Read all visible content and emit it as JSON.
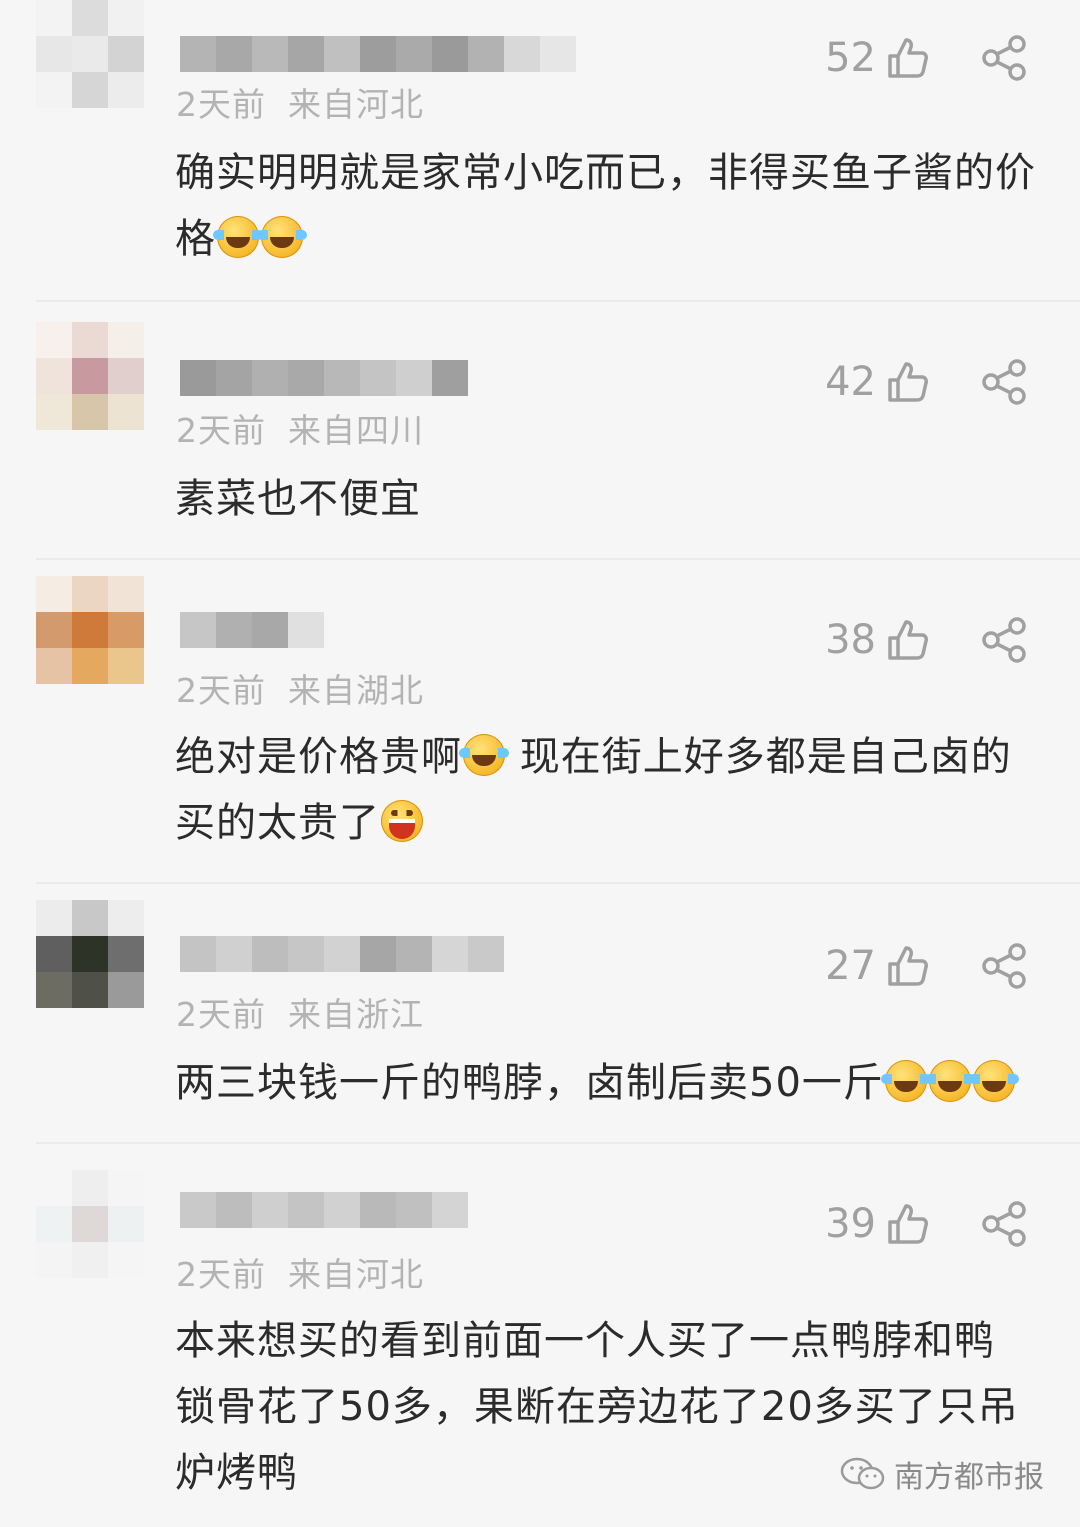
{
  "comments": [
    {
      "time": "2天前",
      "location": "来自河北",
      "likes": "52",
      "text": "确实明明就是家常小吃而已，非得买鱼子酱的价格",
      "emoji_after": [
        "laugh-cry-emoji",
        "laugh-cry-emoji"
      ],
      "avatar_colors": [
        "#f3f3f3",
        "#dcdcdc",
        "#f1f1f1",
        "#e7e7e7",
        "#eaeaea",
        "#d3d3d3",
        "#f3f3f3",
        "#d6d6d6",
        "#ececec"
      ]
    },
    {
      "time": "2天前",
      "location": "来自四川",
      "likes": "42",
      "text": "素菜也不便宜",
      "emoji_after": [],
      "avatar_colors": [
        "#f7f0ec",
        "#eadad3",
        "#f5efea",
        "#efe3db",
        "#c89aa0",
        "#e0cfcc",
        "#efe8d9",
        "#d7c6aa",
        "#ece3d2"
      ]
    },
    {
      "time": "2天前",
      "location": "来自湖北",
      "likes": "38",
      "text": "绝对是价格贵啊",
      "text_2": "现在街上好多都是自己卤的买的太贵了",
      "emoji_after": [
        "laugh-cry-emoji"
      ],
      "emoji_end": [
        "grin-emoji"
      ],
      "avatar_colors": [
        "#f5ece3",
        "#ebd6c3",
        "#f1e4d7",
        "#d39a6d",
        "#cf7a3a",
        "#d89b67",
        "#e6c3a4",
        "#e4a85e",
        "#eac68d"
      ]
    },
    {
      "time": "2天前",
      "location": "来自浙江",
      "likes": "27",
      "text": "两三块钱一斤的鸭脖，卤制后卖50一斤",
      "emoji_after": [
        "laugh-cry-emoji",
        "laugh-cry-emoji",
        "laugh-cry-emoji"
      ],
      "avatar_colors": [
        "#ececec",
        "#c8c8c8",
        "#ededed",
        "#5f5f5f",
        "#2e3328",
        "#6e6e6e",
        "#6d6c62",
        "#4f5149",
        "#9a9a9a"
      ]
    },
    {
      "time": "2天前",
      "location": "来自河北",
      "likes": "39",
      "text": "本来想买的看到前面一个人买了一点鸭脖和鸭锁骨花了50多，果断在旁边花了20多买了只吊炉烤鸭",
      "emoji_after": [],
      "avatar_colors": [
        "#f6f6f6",
        "#eeeeee",
        "#f5f5f5",
        "#eef2f2",
        "#ded9d6",
        "#eef1f2",
        "#f4f4f4",
        "#f0f0f0",
        "#f5f5f5"
      ]
    }
  ],
  "watermark": {
    "text": "南方都市报",
    "icon": "wechat-official-account-icon"
  },
  "colors": {
    "background": "#f6f6f6",
    "meta_text": "#b3b3b3",
    "body_text": "#2b2b2b",
    "icon": "#a0a0a0"
  }
}
